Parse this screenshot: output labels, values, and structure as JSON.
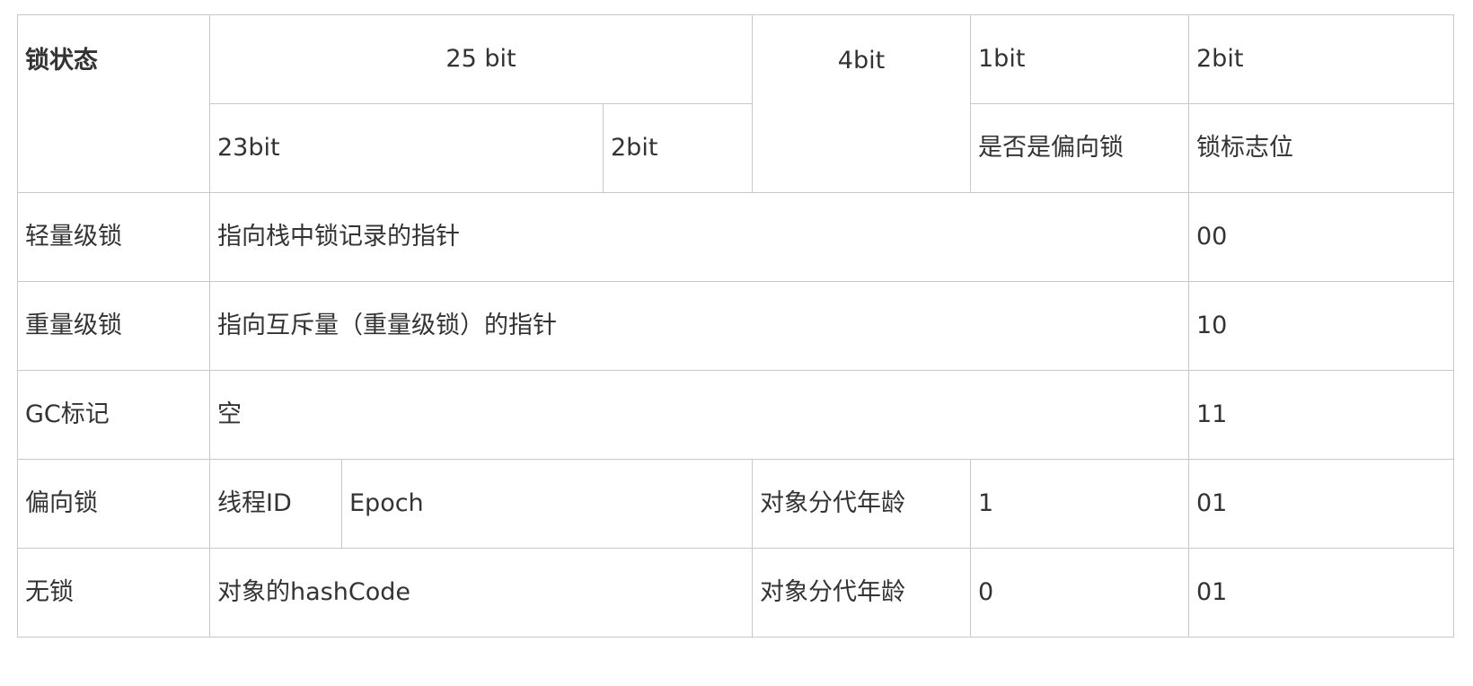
{
  "header": {
    "lock_state": "锁状态",
    "bits_25": "25 bit",
    "bits_4": "4bit",
    "bits_1": "1bit",
    "bits_2": "2bit",
    "bits_23": "23bit",
    "bits_2_sub": "2bit",
    "is_biased": "是否是偏向锁",
    "lock_flag": "锁标志位"
  },
  "rows": {
    "lightweight": {
      "state": "轻量级锁",
      "content": "指向栈中锁记录的指针",
      "flag": "00"
    },
    "heavyweight": {
      "state": "重量级锁",
      "content": "指向互斥量（重量级锁）的指针",
      "flag": "10"
    },
    "gc": {
      "state": "GC标记",
      "content": "空",
      "flag": "11"
    },
    "biased": {
      "state": "偏向锁",
      "thread_id": "线程ID",
      "epoch": "Epoch",
      "age": "对象分代年龄",
      "biased_bit": "1",
      "flag": "01"
    },
    "unlocked": {
      "state": "无锁",
      "hashcode": "对象的hashCode",
      "age": "对象分代年龄",
      "biased_bit": "0",
      "flag": "01"
    }
  }
}
